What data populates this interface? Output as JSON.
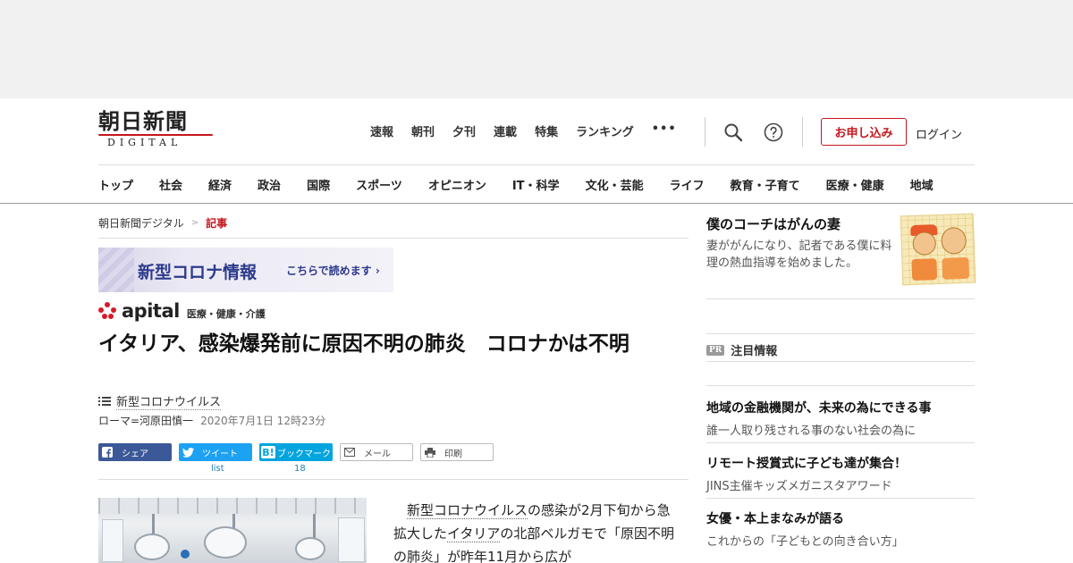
{
  "header": {
    "logo_main": "朝日新聞",
    "logo_sub": "DIGITAL",
    "top_nav": [
      "速報",
      "朝刊",
      "夕刊",
      "連載",
      "特集",
      "ランキング",
      "•••"
    ],
    "apply_label": "お申し込み",
    "login_label": "ログイン"
  },
  "category_nav": [
    "トップ",
    "社会",
    "経済",
    "政治",
    "国際",
    "スポーツ",
    "オピニオン",
    "IT・科学",
    "文化・芸能",
    "ライフ",
    "教育・子育て",
    "医療・健康",
    "地域"
  ],
  "breadcrumb": {
    "home": "朝日新聞デジタル",
    "separator": ">",
    "current": "記事"
  },
  "banner": {
    "title": "新型コロナ情報",
    "cta": "こちらで読めます ›"
  },
  "apital": {
    "word": "apital",
    "tag": "医療・健康・介護"
  },
  "article": {
    "headline": "イタリア、感染爆発前に原因不明の肺炎　コロナかは不明",
    "topic": "新型コロナウイルス",
    "author": "ローマ=河原田慎一",
    "date": "2020年7月1日 12時23分",
    "body": {
      "line1_pre": "　",
      "link1": "新型コロナウイルス",
      "line1_post": "の感染が2月下旬から急拡大した",
      "link2": "イタリア",
      "line2_post": "の北部ベルガモで「原因不明の肺炎」が昨年11月から広が"
    }
  },
  "share": {
    "facebook": "シェア",
    "twitter": "ツイート",
    "twitter_count": "list",
    "hatena": "ブックマーク",
    "hatena_count": "18",
    "mail": "メール",
    "print": "印刷"
  },
  "sidebar": {
    "promo_title": "僕のコーチはがんの妻",
    "promo_desc": "妻ががんになり、記者である僕に料理の熱血指導を始めました。",
    "pr_badge": "PR",
    "pr_heading": "注目情報",
    "pr_items": [
      {
        "title": "地域の金融機関が、未来の為にできる事",
        "sub": "誰一人取り残される事のない社会の為に"
      },
      {
        "title": "リモート授賞式に子ども達が集合！",
        "sub": "JINS主催キッズメガニスタアワード"
      },
      {
        "title": "女優・本上まなみが語る",
        "sub": "これからの「子どもとの向き合い方」"
      }
    ]
  },
  "colors": {
    "brand_red": "#c4161c",
    "facebook": "#3b5998",
    "twitter": "#1da1f2",
    "hatena": "#00a4de",
    "banner_text": "#2d3a8c"
  }
}
